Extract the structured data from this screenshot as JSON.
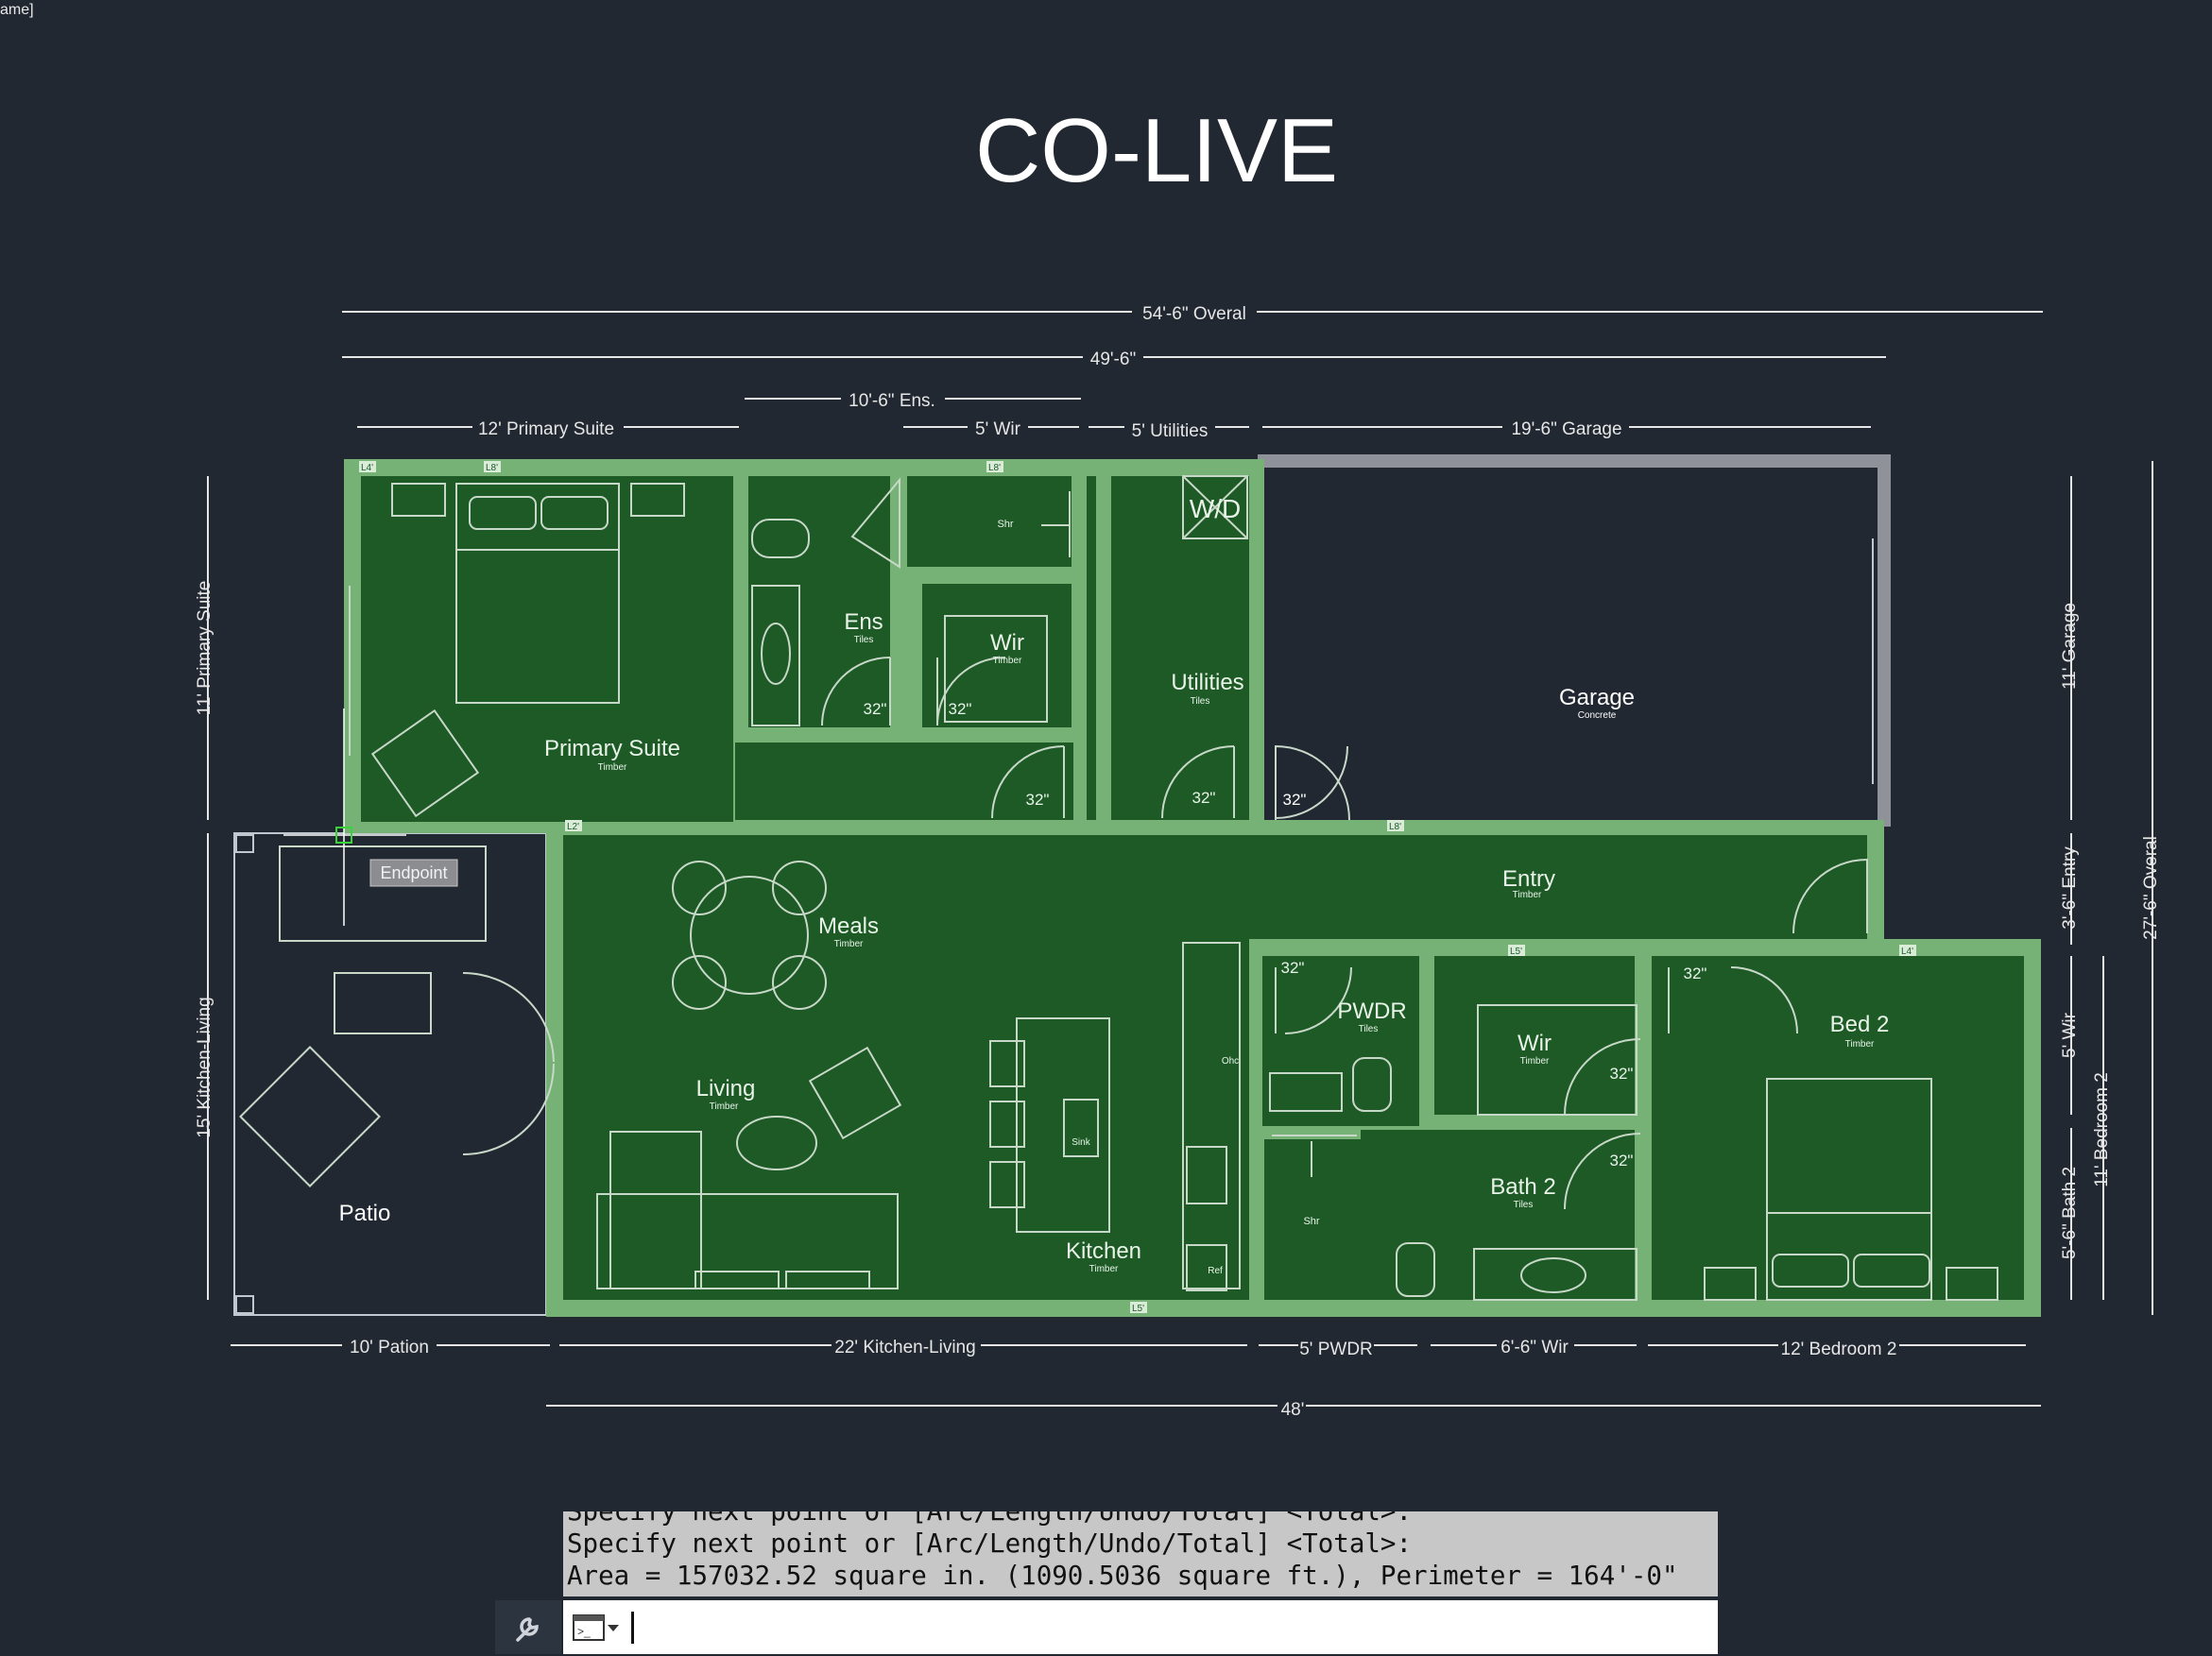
{
  "window": {
    "title_fragment": "ame]"
  },
  "drawing": {
    "title": "CO-LIVE",
    "rooms": [
      {
        "name": "Primary Suite",
        "finish": "Timber"
      },
      {
        "name": "Ens",
        "finish": "Tiles"
      },
      {
        "name": "Wir",
        "finish": "Timber"
      },
      {
        "name": "Utilities",
        "finish": "Tiles"
      },
      {
        "name": "Garage",
        "finish": "Concrete"
      },
      {
        "name": "Entry",
        "finish": "Timber"
      },
      {
        "name": "Meals",
        "finish": "Timber"
      },
      {
        "name": "Living",
        "finish": "Timber"
      },
      {
        "name": "Kitchen",
        "finish": "Timber"
      },
      {
        "name": "PWDR",
        "finish": "Tiles"
      },
      {
        "name": "Wir",
        "finish": "Timber"
      },
      {
        "name": "Bath 2",
        "finish": "Tiles"
      },
      {
        "name": "Bed 2",
        "finish": "Timber"
      },
      {
        "name": "Patio",
        "finish": ""
      }
    ],
    "fixtures": {
      "shower_top": "Shr",
      "washer_dryer": "W/D",
      "shower_bath2": "Shr",
      "sink": "Sink",
      "oven": "Ohc",
      "fridge": "Ref",
      "door_width": "32\""
    },
    "dims": {
      "overall_top": "54'-6\" Overal",
      "main_top": "49'-6\"",
      "ens": "10'-6\" Ens.",
      "primary": "12' Primary Suite",
      "wir": "5' Wir",
      "utilities": "5' Utilities",
      "garage": "19'-6\" Garage",
      "left_primary": "11' Primary Suite",
      "left_kitchen": "15' Kitchen-Living",
      "right_garage": "11' Garage",
      "right_entry": "3'-6\" Entry",
      "right_wir": "5' Wir",
      "right_bath": "5'-6\" Bath 2",
      "right_bed": "11' Bedroom 2",
      "right_overall": "27'-6\" Overal",
      "bot_patio": "10' Pation",
      "bot_kitchen": "22' Kitchen-Living",
      "bot_pwdr": "5' PWDR",
      "bot_wir": "6'-6\" Wir",
      "bot_bed": "12' Bedroom 2",
      "bot_overall": "48'"
    },
    "lintels": [
      "L4'",
      "L8'",
      "L2'",
      "L5'",
      "L8'",
      "L4'",
      "L5'"
    ],
    "snap_tooltip": "Endpoint"
  },
  "command_line": {
    "history": [
      "Specify next point or [Arc/Length/Undo/Total] <Total>:",
      "Specify next point or [Arc/Length/Undo/Total] <Total>:",
      "Area = 157032.52 square in. (1090.5036 square ft.), Perimeter = 164'-0\""
    ],
    "input_value": ""
  },
  "colors": {
    "background": "#222831",
    "floor": "#1d5a26",
    "wall": "#76b275",
    "command_history_bg": "#c7c7c7"
  }
}
